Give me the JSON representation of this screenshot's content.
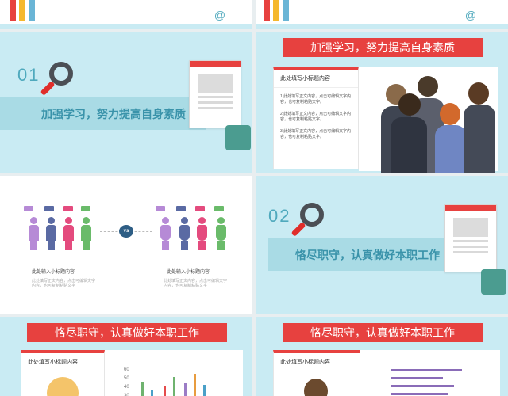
{
  "slides": {
    "s2": {
      "num": "01",
      "title": "加强学习，努力提高自身素质"
    },
    "s3": {
      "banner": "加强学习，努力提高自身素质",
      "panel_title": "此处填写小标题内容",
      "items": [
        "1.此处填写正文内容，点击可编辑文字内容，也可复制粘贴文字。",
        "2.此处填写正文内容，点击可编辑文字内容，也可复制粘贴文字。",
        "3.此处填写正文内容，点击可编辑文字内容，也可复制粘贴文字。"
      ]
    },
    "s4": {
      "vs": "vs",
      "left_title": "此处输入小标题内容",
      "right_title": "此处输入小标题内容",
      "left_body": "此处填写正文内容，点击可编辑文字内容，也可复制粘贴文字",
      "right_body": "此处填写正文内容，点击可编辑文字内容，也可复制粘贴文字"
    },
    "s5": {
      "num": "02",
      "title": "恪尽职守，认真做好本职工作"
    },
    "s6": {
      "banner": "恪尽职守，认真做好本职工作",
      "panel_title": "此处填写小标题内容",
      "y_ticks": [
        "60",
        "50",
        "40",
        "30"
      ]
    },
    "s7": {
      "banner": "恪尽职守，认真做好本职工作",
      "panel_title": "此处填写小标题内容"
    }
  },
  "colors": {
    "accent": "#e7413f",
    "teal": "#4fa9bd",
    "bg": "#c9ebf3"
  }
}
